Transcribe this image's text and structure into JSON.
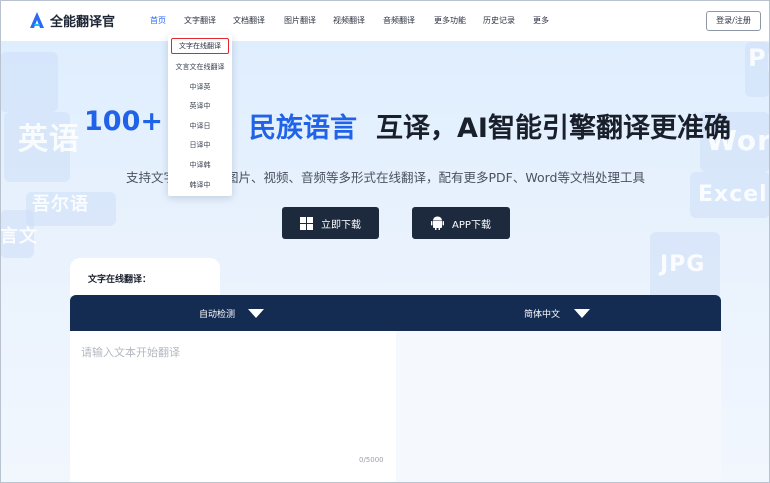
{
  "brand": {
    "name": "全能翻译官",
    "accent": "#2a6af6"
  },
  "nav": [
    {
      "label": "首页",
      "active": true
    },
    {
      "label": "文字翻译"
    },
    {
      "label": "文档翻译"
    },
    {
      "label": "图片翻译"
    },
    {
      "label": "视频翻译"
    },
    {
      "label": "音频翻译"
    },
    {
      "label": "更多功能"
    },
    {
      "label": "历史记录"
    },
    {
      "label": "更多"
    }
  ],
  "login_label": "登录/注册",
  "dropdown": {
    "items": [
      "文字在线翻译",
      "文言文在线翻译",
      "中译英",
      "英译中",
      "中译日",
      "日译中",
      "中译韩",
      "韩译中"
    ]
  },
  "hero": {
    "headline_num": "100+",
    "headline_lang": "民族语言",
    "headline_rest": "互译，AI智能引擎翻译更准确",
    "subline_a": "支持文字",
    "subline_b": "图片、视频、音频等多形式在线翻译，配有更多PDF、Word等文档处理工具",
    "download_btn": "立即下载",
    "app_btn": "APP下载",
    "deco_words": [
      "英语",
      "Word",
      "Excel",
      "JPG",
      "吾尔语",
      "言文",
      "Ppt"
    ]
  },
  "translator": {
    "tab_label": "文字在线翻译：",
    "source_lang": "自动检测",
    "target_lang": "简体中文",
    "placeholder": "请输入文本开始翻译",
    "counter": "0/5000"
  }
}
